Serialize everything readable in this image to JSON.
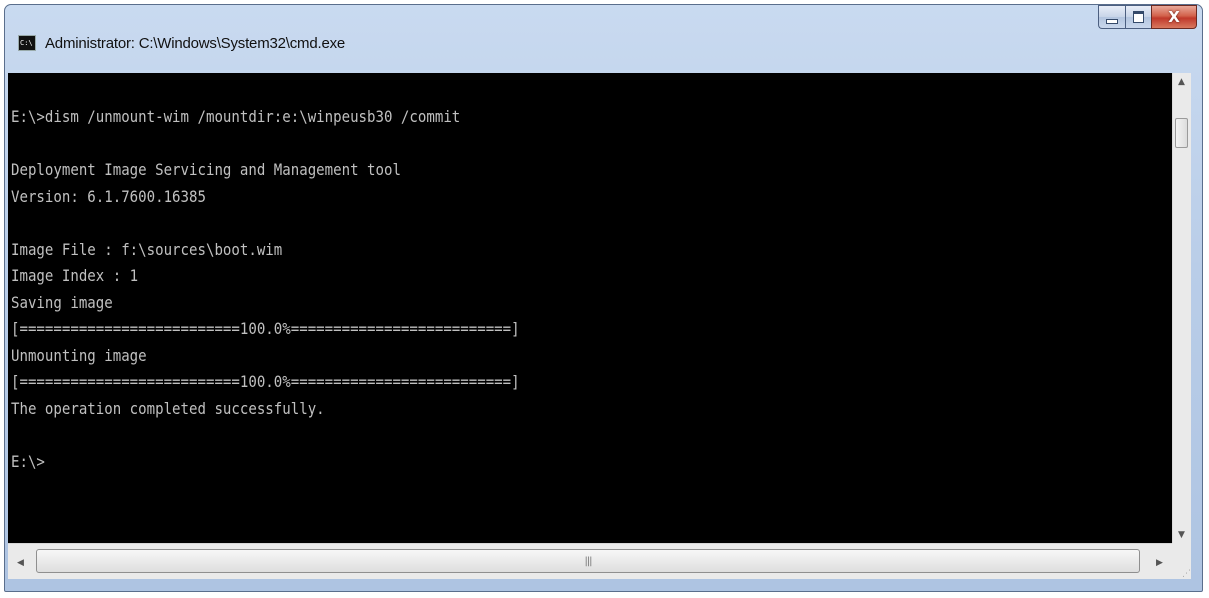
{
  "window": {
    "title": "Administrator: C:\\Windows\\System32\\cmd.exe",
    "icon": "cmd-icon",
    "icon_text": "C:\\",
    "minimize_icon": "minimize-icon",
    "maximize_icon": "maximize-icon",
    "close_label": "X"
  },
  "console": {
    "lines": [
      "E:\\>dism /unmount-wim /mountdir:e:\\winpeusb30 /commit",
      "",
      "Deployment Image Servicing and Management tool",
      "Version: 6.1.7600.16385",
      "",
      "Image File : f:\\sources\\boot.wim",
      "Image Index : 1",
      "Saving image",
      "[==========================100.0%==========================]",
      "Unmounting image",
      "[==========================100.0%==========================]",
      "The operation completed successfully.",
      "",
      "E:\\>"
    ],
    "colors": {
      "background": "#000000",
      "foreground": "#c0c0c0"
    }
  },
  "scrollbars": {
    "vertical": {
      "up_icon": "arrow-up-icon",
      "up": "▲",
      "down_icon": "arrow-down-icon",
      "down": "▼"
    },
    "horizontal": {
      "left_icon": "arrow-left-icon",
      "left": "◀",
      "right_icon": "arrow-right-icon",
      "right": "▶",
      "grip": "|||"
    },
    "size_grip": "⋰"
  }
}
